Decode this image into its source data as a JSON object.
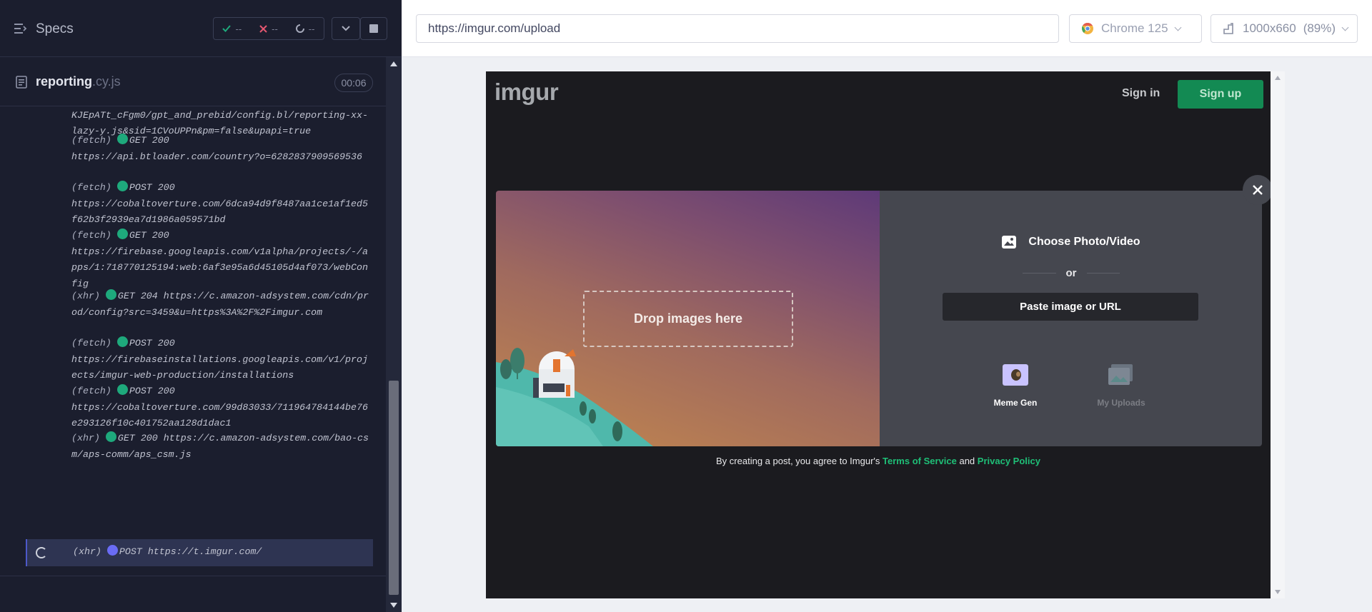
{
  "runner": {
    "title": "Specs",
    "stats": {
      "passed": "--",
      "failed": "--",
      "pending": "--"
    },
    "spec_file": {
      "name": "reporting",
      "ext": ".cy.js",
      "duration": "00:06"
    }
  },
  "log": [
    {
      "text": "y.js&sid=1CVoUPPn&pm=false&upapi=true"
    },
    {
      "kind": "(fetch)",
      "method": "GET 200",
      "url": "https://api.btloader.com/country?o=6282837909569536"
    },
    {
      "kind": "(fetch)",
      "method": "POST 200",
      "url": "https://cobaltoverture.com/6dca94d9f8487aa1ce1af1ed5f62b3f2939ea7d1986a059571bd"
    },
    {
      "kind": "(fetch)",
      "method": "GET 200",
      "url": "https://firebase.googleapis.com/v1alpha/projects/-/apps/1:718770125194:web:6af3e95a6d45105d4af073/webConfig"
    },
    {
      "kind": "(xhr)",
      "method": "GET 204",
      "url": "https://c.amazon-adsystem.com/cdn/prod/config?src=3459&u=https%3A%2F%2Fimgur.com"
    },
    {
      "kind": "(fetch)",
      "method": "POST 200",
      "url": "https://firebaseinstallations.googleapis.com/v1/projects/imgur-web-production/installations"
    },
    {
      "kind": "(fetch)",
      "method": "POST 200",
      "url": "https://cobaltoverture.com/99d83033/711964784144be76e293126f10c401752aa128d1dac1"
    },
    {
      "kind": "(xhr)",
      "method": "GET 200",
      "url": "https://c.amazon-adsystem.com/bao-csm/aps-comm/aps_csm.js"
    }
  ],
  "active_log": {
    "kind": "(xhr)",
    "method": "POST",
    "url": "https://t.imgur.com/"
  },
  "browser": {
    "url": "https://imgur.com/upload",
    "name": "Chrome 125",
    "viewport": "1000x660",
    "zoom": "(89%)"
  },
  "site": {
    "logo": "imgur",
    "sign_in": "Sign in",
    "sign_up": "Sign up",
    "drop_label": "Drop images here",
    "choose_label": "Choose Photo/Video",
    "or_label": "or",
    "paste_label": "Paste image or URL",
    "meme_gen": "Meme Gen",
    "my_uploads": "My Uploads",
    "terms_prefix": "By creating a post, you agree to Imgur's",
    "terms_link": "Terms of Service",
    "terms_and": "and",
    "privacy_link": "Privacy Policy"
  },
  "colors": {
    "runner_bg": "#1b1e2e",
    "pass_green": "#1ea97c",
    "pending_blue": "#6a6cf5",
    "imgur_green": "#1bb76e"
  }
}
